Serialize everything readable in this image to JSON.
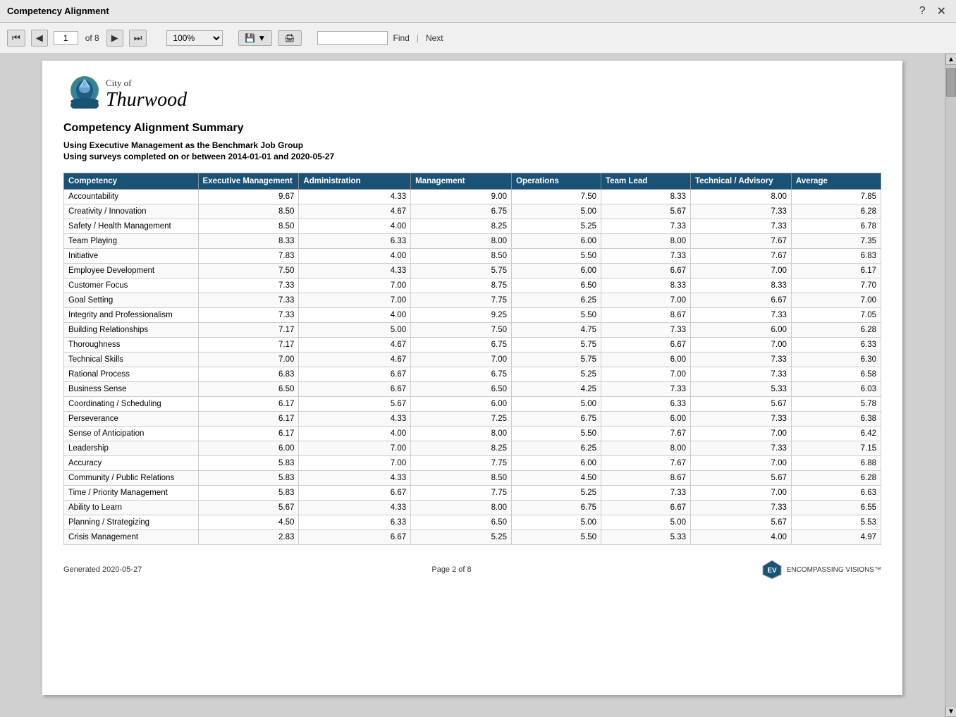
{
  "window": {
    "title": "Competency Alignment"
  },
  "toolbar": {
    "page_current": "1",
    "page_total": "of 8",
    "zoom": "100%",
    "find_placeholder": "",
    "find_label": "Find",
    "next_label": "Next"
  },
  "report": {
    "title": "Competency Alignment Summary",
    "subtitle1": "Using Executive Management as the Benchmark Job Group",
    "subtitle2": "Using surveys completed on or between 2014-01-01 and 2020-05-27"
  },
  "logo": {
    "city_of": "City of",
    "name": "Thurwood"
  },
  "table": {
    "headers": [
      "Competency",
      "Executive Management",
      "Administration",
      "Management",
      "Operations",
      "Team Lead",
      "Technical / Advisory",
      "Average"
    ],
    "rows": [
      [
        "Accountability",
        "9.67",
        "4.33",
        "9.00",
        "7.50",
        "8.33",
        "8.00",
        "7.85"
      ],
      [
        "Creativity / Innovation",
        "8.50",
        "4.67",
        "6.75",
        "5.00",
        "5.67",
        "7.33",
        "6.28"
      ],
      [
        "Safety / Health Management",
        "8.50",
        "4.00",
        "8.25",
        "5.25",
        "7.33",
        "7.33",
        "6.78"
      ],
      [
        "Team Playing",
        "8.33",
        "6.33",
        "8.00",
        "6.00",
        "8.00",
        "7.67",
        "7.35"
      ],
      [
        "Initiative",
        "7.83",
        "4.00",
        "8.50",
        "5.50",
        "7.33",
        "7.67",
        "6.83"
      ],
      [
        "Employee Development",
        "7.50",
        "4.33",
        "5.75",
        "6.00",
        "6.67",
        "7.00",
        "6.17"
      ],
      [
        "Customer Focus",
        "7.33",
        "7.00",
        "8.75",
        "6.50",
        "8.33",
        "8.33",
        "7.70"
      ],
      [
        "Goal Setting",
        "7.33",
        "7.00",
        "7.75",
        "6.25",
        "7.00",
        "6.67",
        "7.00"
      ],
      [
        "Integrity and Professionalism",
        "7.33",
        "4.00",
        "9.25",
        "5.50",
        "8.67",
        "7.33",
        "7.05"
      ],
      [
        "Building Relationships",
        "7.17",
        "5.00",
        "7.50",
        "4.75",
        "7.33",
        "6.00",
        "6.28"
      ],
      [
        "Thoroughness",
        "7.17",
        "4.67",
        "6.75",
        "5.75",
        "6.67",
        "7.00",
        "6.33"
      ],
      [
        "Technical Skills",
        "7.00",
        "4.67",
        "7.00",
        "5.75",
        "6.00",
        "7.33",
        "6.30"
      ],
      [
        "Rational Process",
        "6.83",
        "6.67",
        "6.75",
        "5.25",
        "7.00",
        "7.33",
        "6.58"
      ],
      [
        "Business Sense",
        "6.50",
        "6.67",
        "6.50",
        "4.25",
        "7.33",
        "5.33",
        "6.03"
      ],
      [
        "Coordinating / Scheduling",
        "6.17",
        "5.67",
        "6.00",
        "5.00",
        "6.33",
        "5.67",
        "5.78"
      ],
      [
        "Perseverance",
        "6.17",
        "4.33",
        "7.25",
        "6.75",
        "6.00",
        "7.33",
        "6.38"
      ],
      [
        "Sense of Anticipation",
        "6.17",
        "4.00",
        "8.00",
        "5.50",
        "7.67",
        "7.00",
        "6.42"
      ],
      [
        "Leadership",
        "6.00",
        "7.00",
        "8.25",
        "6.25",
        "8.00",
        "7.33",
        "7.15"
      ],
      [
        "Accuracy",
        "5.83",
        "7.00",
        "7.75",
        "6.00",
        "7.67",
        "7.00",
        "6.88"
      ],
      [
        "Community / Public Relations",
        "5.83",
        "4.33",
        "8.50",
        "4.50",
        "8.67",
        "5.67",
        "6.28"
      ],
      [
        "Time / Priority Management",
        "5.83",
        "6.67",
        "7.75",
        "5.25",
        "7.33",
        "7.00",
        "6.63"
      ],
      [
        "Ability to Learn",
        "5.67",
        "4.33",
        "8.00",
        "6.75",
        "6.67",
        "7.33",
        "6.55"
      ],
      [
        "Planning / Strategizing",
        "4.50",
        "6.33",
        "6.50",
        "5.00",
        "5.00",
        "5.67",
        "5.53"
      ],
      [
        "Crisis Management",
        "2.83",
        "6.67",
        "5.25",
        "5.50",
        "5.33",
        "4.00",
        "4.97"
      ]
    ]
  },
  "footer": {
    "generated": "Generated 2020-05-27",
    "page_label": "Page 2 of 8",
    "logo_text": "ENCOMPASSING VISIONS™"
  }
}
